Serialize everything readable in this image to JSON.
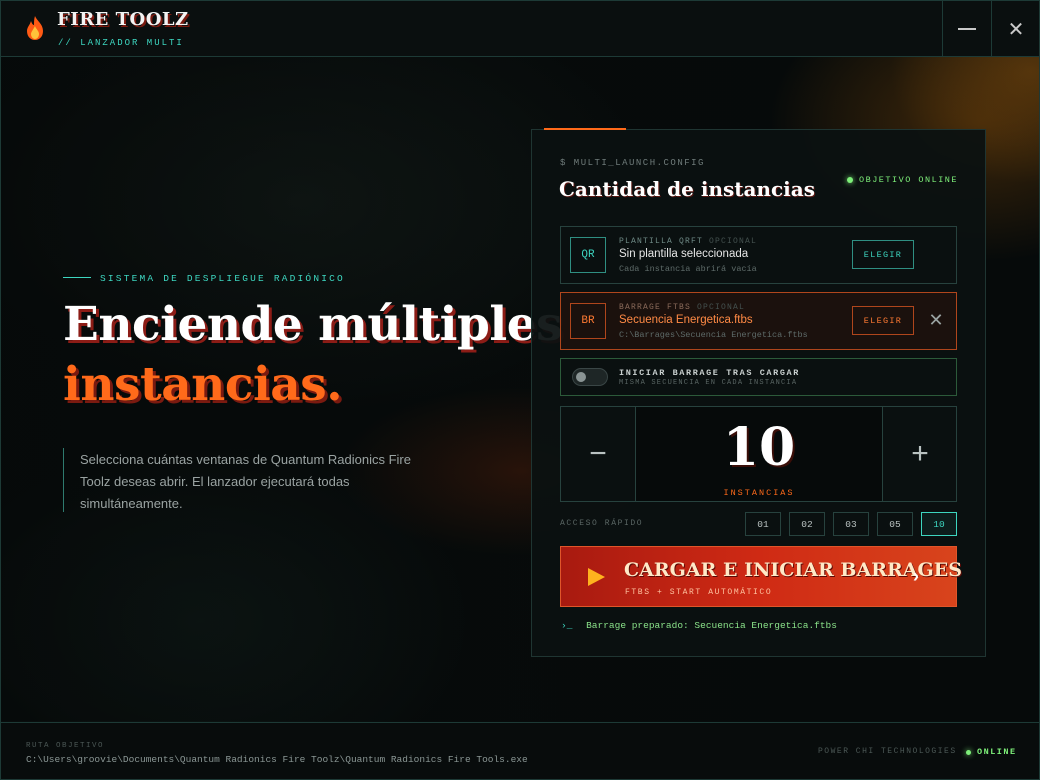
{
  "window": {
    "title": "FIRE TOOLZ",
    "subtitle": "// LANZADOR MULTI",
    "minimize_icon": "minimize-icon",
    "close_icon": "close-icon"
  },
  "hero": {
    "eyebrow": "SISTEMA DE DESPLIEGUE RADIÓNICO",
    "headline_line1": "Enciende múltiples",
    "headline_line2": "instancias.",
    "description": "Selecciona cuántas ventanas de Quantum Radionics Fire Toolz deseas abrir. El lanzador ejecutará todas simultáneamente."
  },
  "panel": {
    "config_label": "$ MULTI_LAUNCH.CONFIG",
    "title": "Cantidad de instancias",
    "status": "OBJETIVO ONLINE",
    "template": {
      "badge": "QR",
      "kicker": "PLANTILLA QRFT",
      "optional": "OPCIONAL",
      "value": "Sin plantilla seleccionada",
      "sub": "Cada instancia abrirá vacía",
      "button": "ELEGIR"
    },
    "barrage": {
      "badge": "BR",
      "kicker": "BARRAGE FTBS",
      "optional": "OPCIONAL",
      "value": "Secuencia Energetica.ftbs",
      "sub": "C:\\Barrages\\Secuencia Energetica.ftbs",
      "button": "ELEGIR",
      "clear_icon": "close-icon"
    },
    "toggle": {
      "label": "INICIAR BARRAGE TRAS CARGAR",
      "sub": "MISMA SECUENCIA EN CADA INSTANCIA",
      "on": false
    },
    "stepper": {
      "minus": "−",
      "value": "10",
      "unit": "INSTANCIAS",
      "plus": "+"
    },
    "quick": {
      "label": "ACCESO RÁPIDO",
      "options": [
        "01",
        "02",
        "03",
        "05",
        "10"
      ],
      "selected": "10"
    },
    "launch": {
      "title": "CARGAR E INICIAR BARRAGES",
      "sub": "FTBS + START AUTOMÁTICO",
      "arrow": "›"
    },
    "log": {
      "prompt": "›_",
      "message": "Barrage preparado: Secuencia Energetica.ftbs"
    }
  },
  "footer": {
    "path_label": "RUTA OBJETIVO",
    "path_value": "C:\\Users\\groovie\\Documents\\Quantum Radionics Fire Toolz\\Quantum Radionics Fire Tools.exe",
    "vendor": "POWER CHI TECHNOLOGIES",
    "status": "ONLINE"
  },
  "colors": {
    "accent_teal": "#3dd6c0",
    "accent_orange": "#ff6a1a",
    "launch_red": "#cf2a14",
    "online_green": "#7ef07a"
  }
}
